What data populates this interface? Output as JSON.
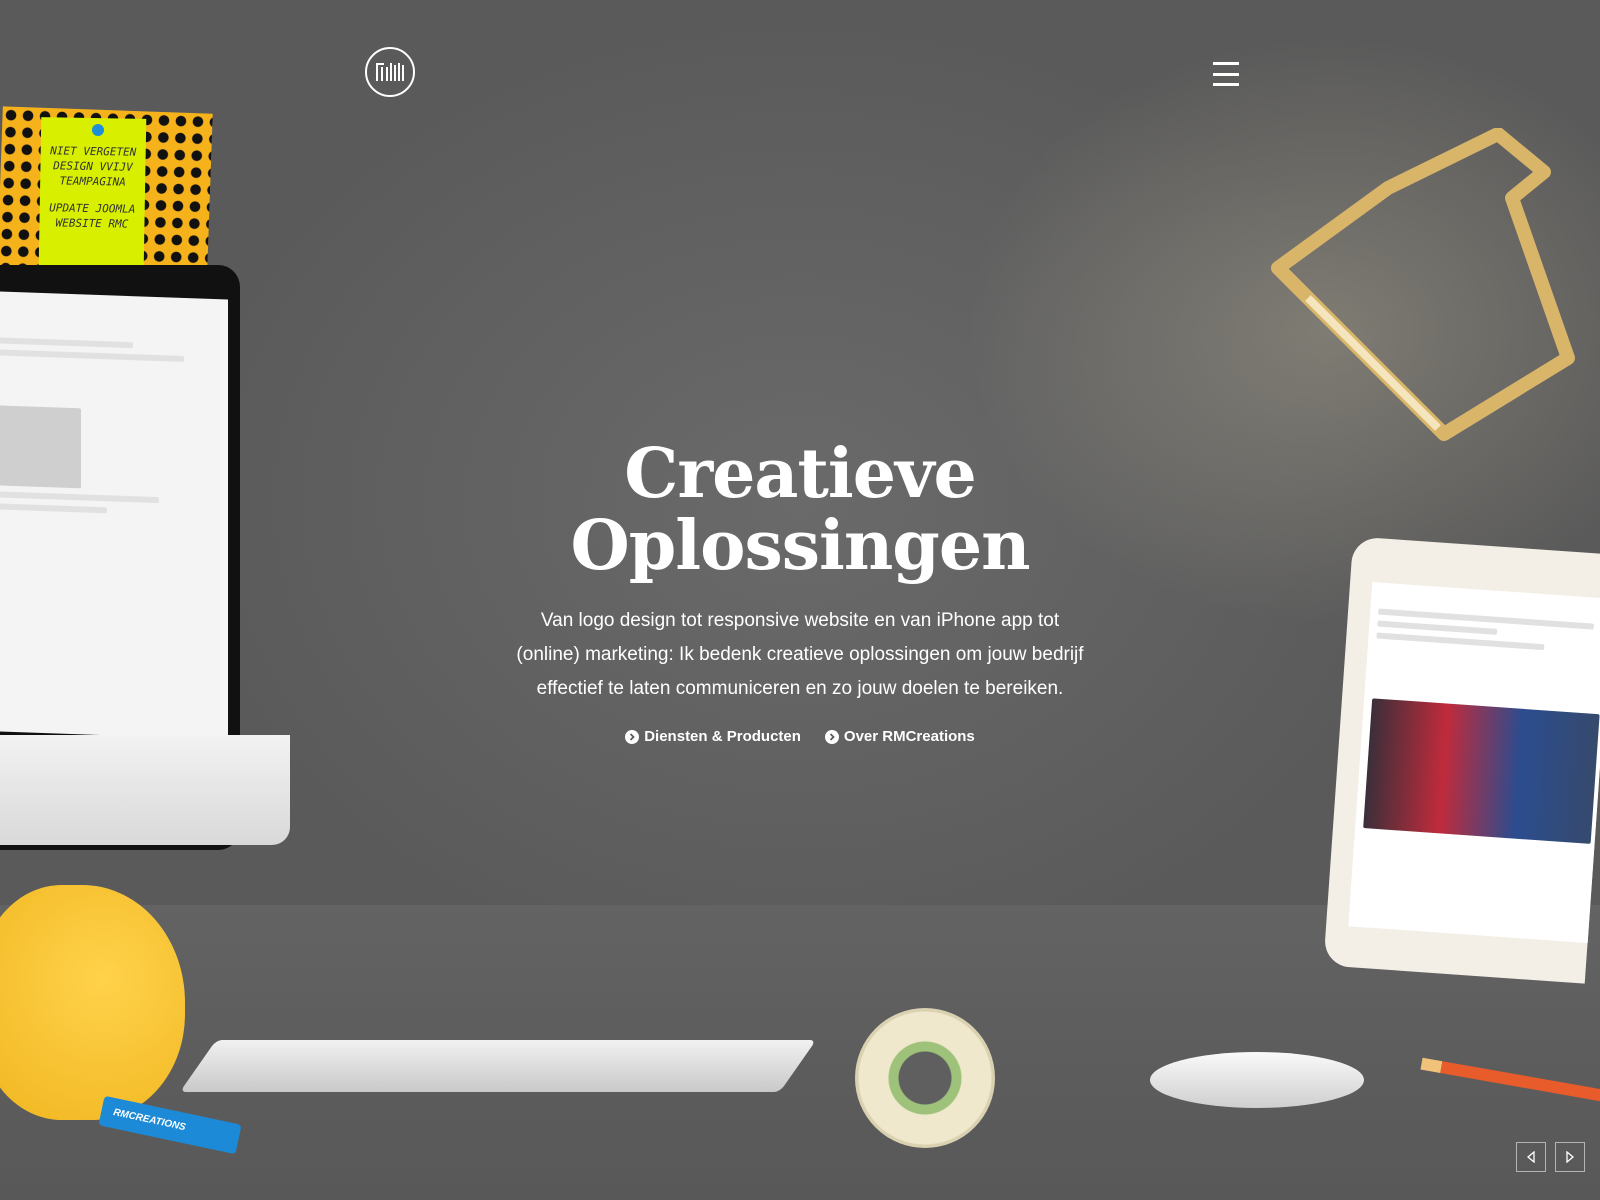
{
  "header": {
    "logo_icon": "rmc-logo-icon",
    "menu_icon": "hamburger-menu-icon"
  },
  "hero": {
    "title_line1": "Creatieve",
    "title_line2": "Oplossingen",
    "text_line1": "Van logo design tot responsive website en van iPhone app tot",
    "text_line2": "(online) marketing: Ik bedenk creatieve oplossingen om jouw bedrijf",
    "text_line3": "effectief te laten communiceren en zo jouw doelen te bereiken.",
    "links": [
      {
        "label": "Diensten & Producten",
        "icon": "chevron-right-circle-icon"
      },
      {
        "label": "Over RMCreations",
        "icon": "chevron-right-circle-icon"
      }
    ]
  },
  "slider": {
    "prev_icon": "triangle-left-icon",
    "next_icon": "triangle-right-icon"
  },
  "scene": {
    "sticky_note_lines": [
      "NIET VERGETEN",
      "DESIGN VVIJV",
      "TEAMPAGINA",
      "UPDATE JOOMLA",
      "WEBSITE RMC"
    ],
    "marker_label": "RMCREATIONS"
  },
  "colors": {
    "background": "#5c5c5c",
    "text": "#ffffff",
    "sticky_note": "#d8f000",
    "board": "#f6b21b",
    "marker": "#1c8ad6"
  }
}
